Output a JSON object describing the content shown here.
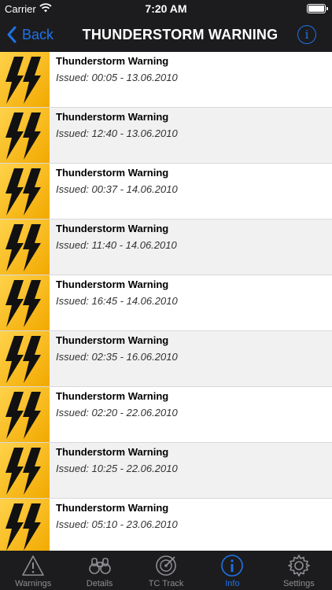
{
  "status_bar": {
    "carrier": "Carrier",
    "time": "7:20 AM"
  },
  "nav": {
    "back_label": "Back",
    "title": "THUNDERSTORM WARNING"
  },
  "warnings": [
    {
      "title": "Thunderstorm Warning",
      "issued": "Issued: 00:05 - 13.06.2010"
    },
    {
      "title": "Thunderstorm Warning",
      "issued": "Issued: 12:40 - 13.06.2010"
    },
    {
      "title": "Thunderstorm Warning",
      "issued": "Issued: 00:37 - 14.06.2010"
    },
    {
      "title": "Thunderstorm Warning",
      "issued": "Issued: 11:40 - 14.06.2010"
    },
    {
      "title": "Thunderstorm Warning",
      "issued": "Issued: 16:45 - 14.06.2010"
    },
    {
      "title": "Thunderstorm Warning",
      "issued": "Issued: 02:35 - 16.06.2010"
    },
    {
      "title": "Thunderstorm Warning",
      "issued": "Issued: 02:20 - 22.06.2010"
    },
    {
      "title": "Thunderstorm Warning",
      "issued": "Issued: 10:25 - 22.06.2010"
    },
    {
      "title": "Thunderstorm Warning",
      "issued": "Issued: 05:10 - 23.06.2010"
    }
  ],
  "tabs": [
    {
      "label": "Warnings",
      "icon": "warning-triangle-icon"
    },
    {
      "label": "Details",
      "icon": "binoculars-icon"
    },
    {
      "label": "TC Track",
      "icon": "radar-icon"
    },
    {
      "label": "Info",
      "icon": "info-icon",
      "active": true
    },
    {
      "label": "Settings",
      "icon": "gear-icon"
    }
  ],
  "colors": {
    "accent": "#1e73e8",
    "bar": "#1c1c1e",
    "thumb_yellow": "#f7b500"
  }
}
